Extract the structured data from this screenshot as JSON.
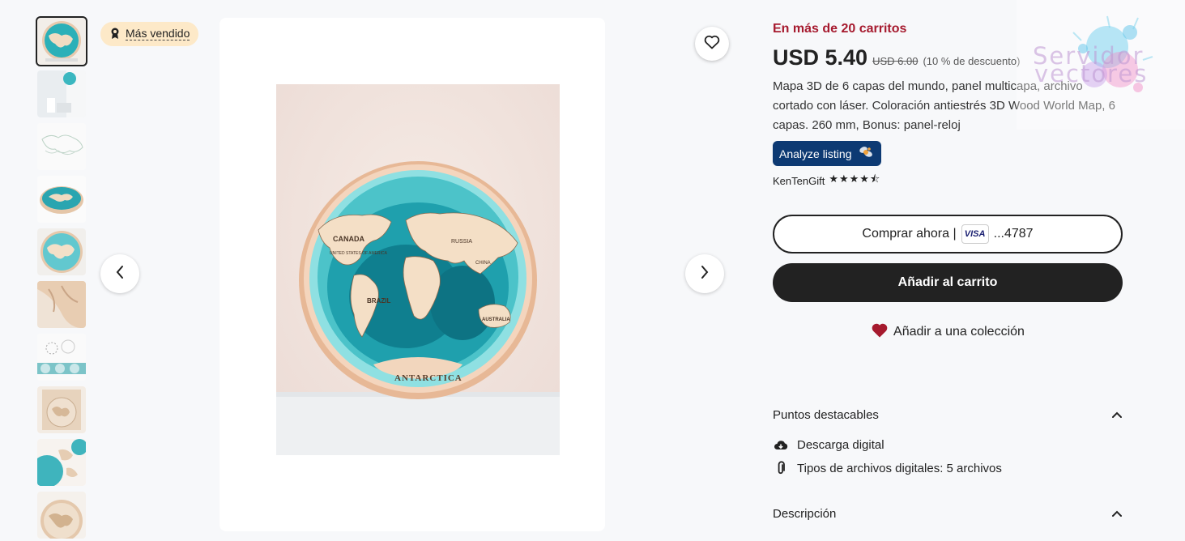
{
  "badge": {
    "label": "Más vendido"
  },
  "product": {
    "carts_text": "En más de 20 carritos",
    "price": "USD 5.40",
    "old_price": "USD 6.00",
    "discount": "(10 % de descuento)",
    "description": "Mapa 3D de 6 capas del mundo, panel multicapa, archivo cortado con láser. Coloración antiestrés 3D Wood World Map, 6 capas. 260 mm, Bonus: panel-reloj",
    "analyze_label": "Analyze listing",
    "shop_name": "KenTenGift",
    "rating_stars": 4.5,
    "rating_display": "★★★★⯪"
  },
  "main_image": {
    "map_labels": [
      "CANADA",
      "BRAZIL",
      "RUSSIA",
      "CHINA",
      "AUSTRALIA",
      "UNITED STATES OF AMERICA",
      "ANTARCTICA"
    ]
  },
  "actions": {
    "buy_now_label": "Comprar ahora |",
    "card_brand": "VISA",
    "card_last4": "...4787",
    "add_to_cart_label": "Añadir al carrito",
    "add_to_collection_label": "Añadir a una colección"
  },
  "highlights": {
    "title": "Puntos destacables",
    "items": [
      {
        "icon": "download-cloud-icon",
        "text": "Descarga digital"
      },
      {
        "icon": "paperclip-icon",
        "text": "Tipos de archivos digitales: 5 archivos"
      }
    ]
  },
  "description_section": {
    "title": "Descripción"
  },
  "watermark": {
    "line1": "Servidor",
    "line2": "vectores"
  },
  "colors": {
    "accent_red": "#a61a2e",
    "dark": "#222222",
    "analyze_bg": "#0d3a73",
    "badge_bg": "#fde9c8",
    "heart": "#a61a2e"
  },
  "thumbnails_count": 10
}
